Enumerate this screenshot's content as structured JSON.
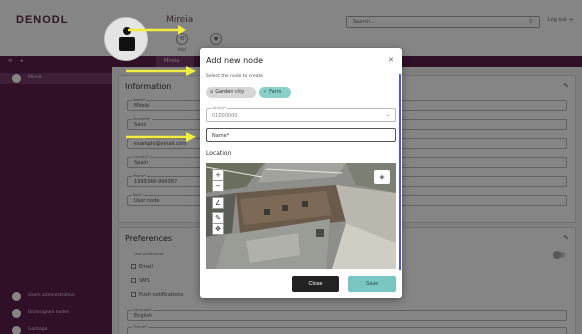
{
  "header": {
    "logo": "DENODL",
    "user_name": "Mireia",
    "btn1_label": "Add",
    "search_placeholder": "Search...",
    "logout_label": "Log out"
  },
  "navbar": {
    "active_item": "Mireia"
  },
  "sidebar": {
    "items": [
      {
        "label": "Mireia",
        "icon": "user-icon"
      },
      {
        "label": "Users administration",
        "icon": "users-icon"
      },
      {
        "label": "Unassigned nodes",
        "icon": "nodes-icon"
      },
      {
        "label": "Garbage",
        "icon": "trash-icon"
      }
    ]
  },
  "information": {
    "title": "Information",
    "fields": [
      {
        "label": "Name*",
        "value": "Mireia"
      },
      {
        "label": "Surname*",
        "value": "Sanz"
      },
      {
        "label": "Email*",
        "value": "example@email.com"
      },
      {
        "label": "Country*",
        "value": "Spain"
      },
      {
        "label": "Phone*",
        "value": "1999346-999387"
      },
      {
        "label": "Role*",
        "value": "User node"
      }
    ]
  },
  "preferences": {
    "title": "Preferences",
    "section_label": "User preferences",
    "checks": [
      "Email",
      "SMS",
      "Push notifications"
    ],
    "language_label": "Language*",
    "language_value": "English",
    "theme_label": "Theme*"
  },
  "modal": {
    "title": "Add new node",
    "subtitle": "Select the node to create",
    "chips": [
      {
        "label": "Garden city",
        "icon": "garden-icon",
        "selected": false
      },
      {
        "label": "Farm",
        "icon": "check-icon",
        "selected": true
      }
    ],
    "variety_label": "Variety*",
    "variety_value": "01000000",
    "name_placeholder": "Name*",
    "location_label": "Location",
    "close_label": "Close",
    "save_label": "Save",
    "colors": {
      "save": "#7cc6c2",
      "chip_selected": "#8ad0c8",
      "scroll": "#4b5bd4"
    }
  },
  "annotations": {
    "color": "#f1ee3f"
  }
}
